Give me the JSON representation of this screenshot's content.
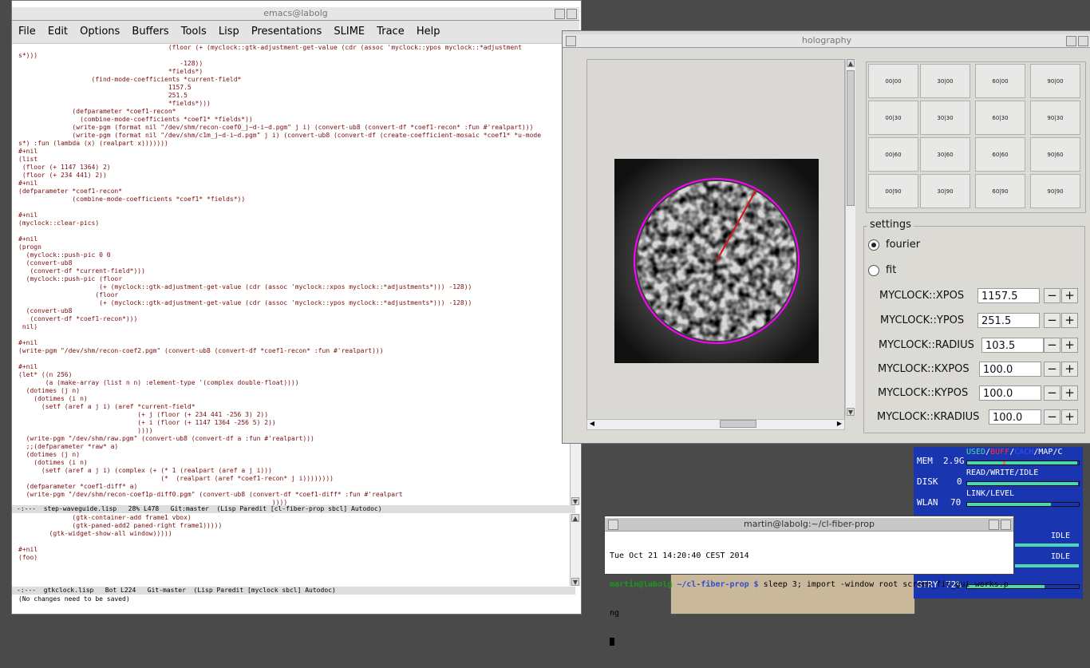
{
  "emacs": {
    "title": "emacs@labolg",
    "menu": [
      "File",
      "Edit",
      "Options",
      "Buffers",
      "Tools",
      "Lisp",
      "Presentations",
      "SLIME",
      "Trace",
      "Help"
    ],
    "code_lines": [
      "                                       (floor (+ (myclock::gtk-adjustment-get-value (cdr (assoc 'myclock::ypos myclock::*adjustment",
      "s*)))",
      "                                          -128))",
      "                                       *fields*)",
      "                   (find-mode-coefficients *current-field*",
      "                                       1157.5",
      "                                       251.5",
      "                                       *fields*)))",
      "              (defparameter *coef1-recon*",
      "                (combine-mode-coefficients *coef1* *fields*))",
      "              (write-pgm (format nil \"/dev/shm/recon-coef0_j~d-i~d.pgm\" j i) (convert-ub8 (convert-df *coef1-recon* :fun #'realpart)))",
      "              (write-pgm (format nil \"/dev/shm/c1m_j~d-i~d.pgm\" j i) (convert-ub8 (convert-df (create-coefficient-mosaic *coef1* *u-mode",
      "s*) :fun (lambda (x) (realpart x)))))))",
      "#+nil",
      "(list",
      " (floor (+ 1147 1364) 2)",
      " (floor (+ 234 441) 2))",
      "#+nil",
      "(defparameter *coef1-recon*",
      "              (combine-mode-coefficients *coef1* *fields*))",
      "",
      "#+nil",
      "(myclock::clear-pics)",
      "",
      "#+nil",
      "(progn",
      "  (myclock::push-pic 0 0",
      "  (convert-ub8",
      "   (convert-df *current-field*)))",
      "  (myclock::push-pic (floor",
      "                     (+ (myclock::gtk-adjustment-get-value (cdr (assoc 'myclock::xpos myclock::*adjustments*))) -128))",
      "                    (floor",
      "                     (+ (myclock::gtk-adjustment-get-value (cdr (assoc 'myclock::ypos myclock::*adjustments*))) -128))",
      "  (convert-ub8",
      "   (convert-df *coef1-recon*)))",
      " nil)",
      "",
      "#+nil",
      "(write-pgm \"/dev/shm/recon-coef2.pgm\" (convert-ub8 (convert-df *coef1-recon* :fun #'realpart)))",
      "",
      "#+nil",
      "(let* ((n 256)",
      "       (a (make-array (list n n) :element-type '(complex double-float))))",
      "  (dotimes (j n)",
      "    (dotimes (i n)",
      "      (setf (aref a j i) (aref *current-field*",
      "                               (+ j (floor (+ 234 441 -256 3) 2))",
      "                               (+ i (floor (+ 1147 1364 -256 5) 2))",
      "                               ))))",
      "  (write-pgm \"/dev/shm/raw.pgm\" (convert-ub8 (convert-df a :fun #'realpart)))",
      "  ;;(defparameter *raw* a)",
      "  (dotimes (j n)",
      "    (dotimes (i n)",
      "      (setf (aref a j i) (complex (+ (* 1 (realpart (aref a j i)))",
      "                                     (*  (realpart (aref *coef1-recon* j i))))))))",
      "  (defparameter *coef1-diff* a)",
      "  (write-pgm \"/dev/shm/recon-coef1p-diff0.pgm\" (convert-ub8 (convert-df *coef1-diff* :fun #'realpart",
      "                                                                  ))))"
    ],
    "modeline_top": "-:---  step-waveguide.lisp   28% L478   Git:master  (Lisp Paredit [cl-fiber-prop sbcl] Autodoc)",
    "code2_lines": [
      "              (gtk-container-add frame1 vbox)",
      "              (gtk-paned-add2 paned-right frame1)))))",
      "        (gtk-widget-show-all window)))))",
      "",
      "#+nil",
      "(foo)"
    ],
    "modeline_bottom": "-:---  gtkclock.lisp   Bot L224   Git-master  (Lisp Paredit [myclock sbcl] Autodoc)",
    "echo": "(No changes need to be saved)"
  },
  "holography": {
    "title": "holography",
    "grid": [
      [
        "00|00",
        "30|00",
        "60|00",
        "90|00"
      ],
      [
        "00|30",
        "30|30",
        "60|30",
        "90|30"
      ],
      [
        "00|60",
        "30|60",
        "60|60",
        "90|60"
      ],
      [
        "00|90",
        "30|90",
        "60|90",
        "90|90"
      ]
    ],
    "settings_label": "settings",
    "radio_fourier": "fourier",
    "radio_fit": "fit",
    "selected_mode": "fourier",
    "params": [
      {
        "label": "MYCLOCK::XPOS",
        "value": "1157.5"
      },
      {
        "label": "MYCLOCK::YPOS",
        "value": "251.5"
      },
      {
        "label": "MYCLOCK::RADIUS",
        "value": "103.5"
      },
      {
        "label": "MYCLOCK::KXPOS",
        "value": "100.0"
      },
      {
        "label": "MYCLOCK::KYPOS",
        "value": "100.0"
      },
      {
        "label": "MYCLOCK::KRADIUS",
        "value": "100.0"
      }
    ],
    "minus": "−",
    "plus": "+",
    "circle_color": "#ff00ff",
    "vector_color": "#dd1111"
  },
  "terminal": {
    "title": "martin@labolg:~/cl-fiber-prop",
    "line1": "Tue Oct 21 14:20:40 CEST 2014",
    "prompt_user": "martin@labolg",
    "prompt_path": " ~/cl-fiber-prop $",
    "command": " sleep 3; import -window root screen_fit_gui_works.p",
    "command_wrap": "ng"
  },
  "conky": {
    "mem_label": "MEM",
    "mem_value": "2.9G",
    "mem_legend": [
      "USED",
      "/",
      "BUFF",
      "/",
      "CACH",
      "/",
      "MAP",
      "/",
      "C"
    ],
    "disk_label": "DISK",
    "disk_value": "0",
    "disk_legend": "READ/WRITE/IDLE",
    "wlan_label": "WLAN",
    "wlan_value": "70",
    "wlan_legend": "LINK/LEVEL",
    "idle1": "IDLE",
    "idle2": "IDLE",
    "btry_label": "BTRY",
    "btry_value": "72%",
    "colors": {
      "bg": "#1a35b0",
      "used": "#4fd7b0",
      "buff": "#ff3030",
      "cach": "#3050ff",
      "bar": "#4fd7b0"
    }
  }
}
